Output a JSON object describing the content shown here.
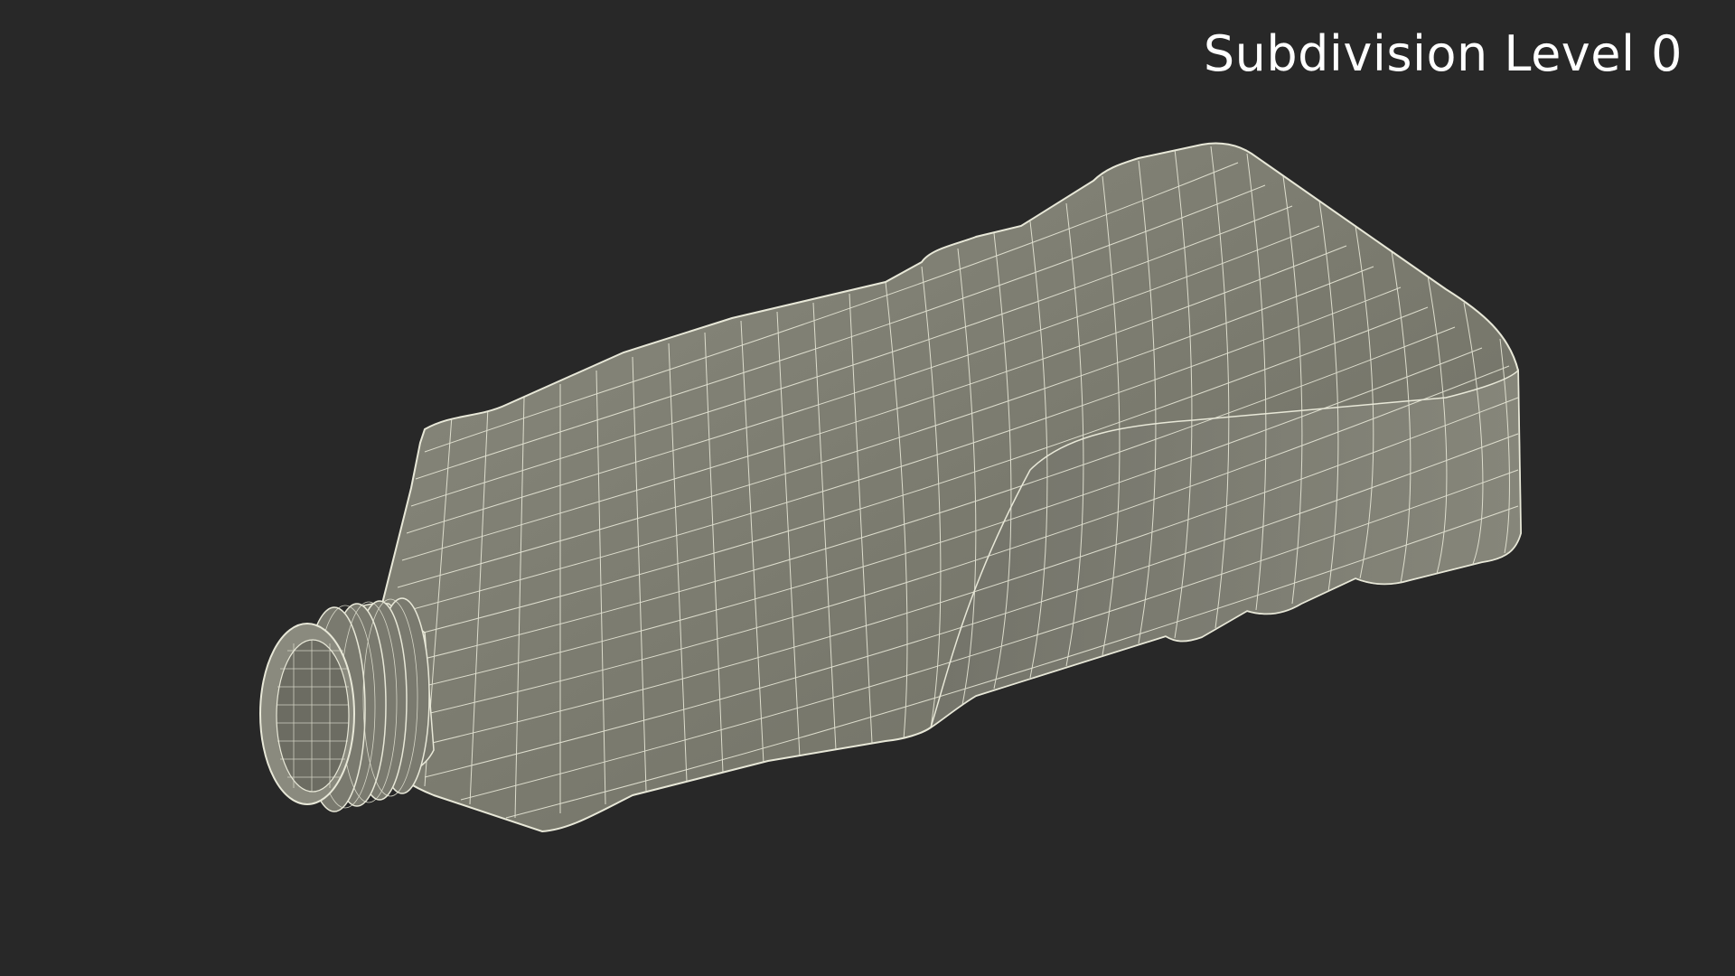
{
  "viewport": {
    "title": "Subdivision Level 0",
    "background_color": "#282828",
    "title_color": "#ffffff"
  },
  "model": {
    "object": "plastic-bottle-icon",
    "display_mode": "wireframe-on-shaded",
    "surface_color": "#7c7c70",
    "wire_color": "#e8e8d8"
  }
}
